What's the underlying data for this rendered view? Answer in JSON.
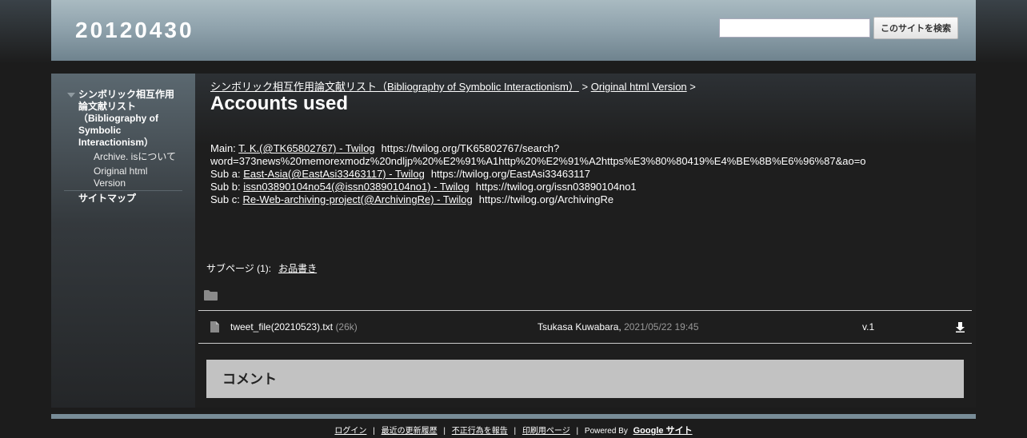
{
  "header": {
    "site_title": "20120430",
    "search_placeholder": "",
    "search_button": "このサイトを検索"
  },
  "sidebar": {
    "items": [
      {
        "label": "シンボリック相互作用論文献リスト（Bibliography of Symbolic Interactionism）"
      },
      {
        "label": "Archive. isについて"
      },
      {
        "label": "Original html Version"
      },
      {
        "label": "サイトマップ"
      }
    ]
  },
  "breadcrumb": {
    "parent": "シンボリック相互作用論文献リスト（Bibliography of Symbolic Interactionism）",
    "sep1": " > ",
    "current": "Original html Version",
    "sep2": " >"
  },
  "page_title": "Accounts used",
  "accounts": [
    {
      "label": "Main: ",
      "link": "T. K.(@TK65802767) - Twilog",
      "url": "https://twilog.org/TK65802767/search?",
      "url2": "word=373news%20memorexmodz%20ndljp%20%E2%91%A1http%20%E2%91%A2https%E3%80%80419%E4%BE%8B%E6%96%87&ao=o"
    },
    {
      "label": "Sub a: ",
      "link": "East-Asia(@EastAsi33463117) - Twilog",
      "url": "https://twilog.org/EastAsi33463117"
    },
    {
      "label": "Sub b: ",
      "link": "issn03890104no54(@issn03890104no1) - Twilog",
      "url": "https://twilog.org/issn03890104no1"
    },
    {
      "label": "Sub c: ",
      "link": "Re-Web-archiving-project(@ArchivingRe) - Twilog",
      "url": "https://twilog.org/ArchivingRe"
    }
  ],
  "subpages": {
    "label": "サブページ (1):",
    "link": "お品書き"
  },
  "attachment": {
    "name": "tweet_file(20210523).txt",
    "size": "(26k)",
    "author": "Tsukasa Kuwabara,",
    "date": "2021/05/22 19:45",
    "version": "v.1"
  },
  "comments": {
    "title": "コメント"
  },
  "footer": {
    "login": "ログイン",
    "recent": "最近の更新履歴",
    "report": "不正行為を報告",
    "print": "印刷用ページ",
    "powered": "Powered By",
    "brand": "Google サイト",
    "sep": "|"
  },
  "icons": {
    "folder": "folder-icon",
    "file": "file-icon",
    "download": "download-icon",
    "expand": "triangle-down-icon"
  },
  "colors": {
    "header": "#90a3ad",
    "background": "#1c1c1c",
    "comment_box": "#c2c2c2",
    "footer_bar": "#788c97"
  }
}
